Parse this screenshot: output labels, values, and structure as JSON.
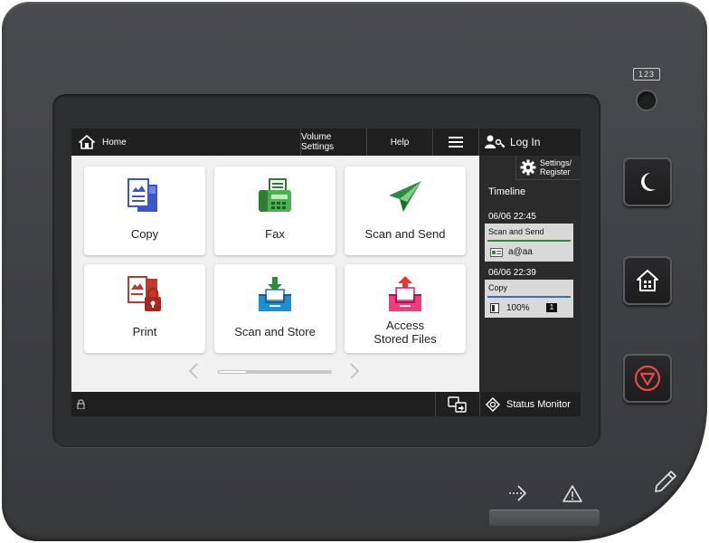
{
  "topbar": {
    "home_label": "Home",
    "volume_settings_label": "Volume Settings",
    "help_label": "Help",
    "login_label": "Log In"
  },
  "tiles": [
    {
      "label": "Copy",
      "icon": "copy-icon"
    },
    {
      "label": "Fax",
      "icon": "fax-icon"
    },
    {
      "label": "Scan and Send",
      "icon": "scan-and-send-icon"
    },
    {
      "label": "Print",
      "icon": "print-icon"
    },
    {
      "label": "Scan and Store",
      "icon": "scan-and-store-icon"
    },
    {
      "label_line1": "Access",
      "label_line2": "Stored Files",
      "icon": "access-stored-files-icon"
    }
  ],
  "rpanel": {
    "settings_line1": "Settings/",
    "settings_line2": "Register",
    "timeline_title": "Timeline",
    "entries": [
      {
        "time": "06/06 22:45",
        "job": "Scan and Send",
        "detail": "a@aa",
        "bar_color": "#2e8b3d"
      },
      {
        "time": "06/06 22:39",
        "job": "Copy",
        "detail": "100%",
        "badge": "1",
        "bar_color": "#2f6fd1"
      }
    ]
  },
  "bottombar": {
    "status_monitor_label": "Status Monitor"
  },
  "hardware": {
    "counter_label": "123"
  },
  "colors": {
    "stop_accent": "#e34b3f",
    "screen_background": "#f1f1f1",
    "panel_dark": "#2b2b2b"
  }
}
